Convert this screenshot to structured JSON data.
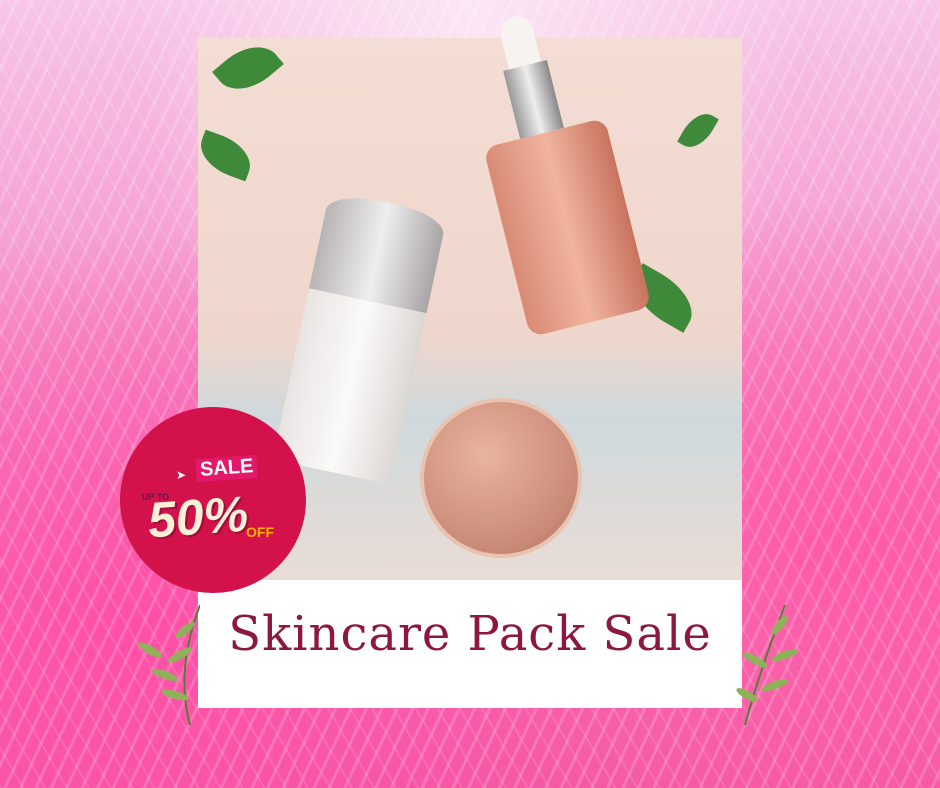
{
  "title": "Skincare Pack Sale",
  "badge": {
    "sale_label": "SALE",
    "up_to": "UP TO",
    "percent": "50%",
    "off_label": "OFF"
  },
  "colors": {
    "title": "#8c1841",
    "badge": "#d3124c",
    "off": "#ffb300"
  }
}
